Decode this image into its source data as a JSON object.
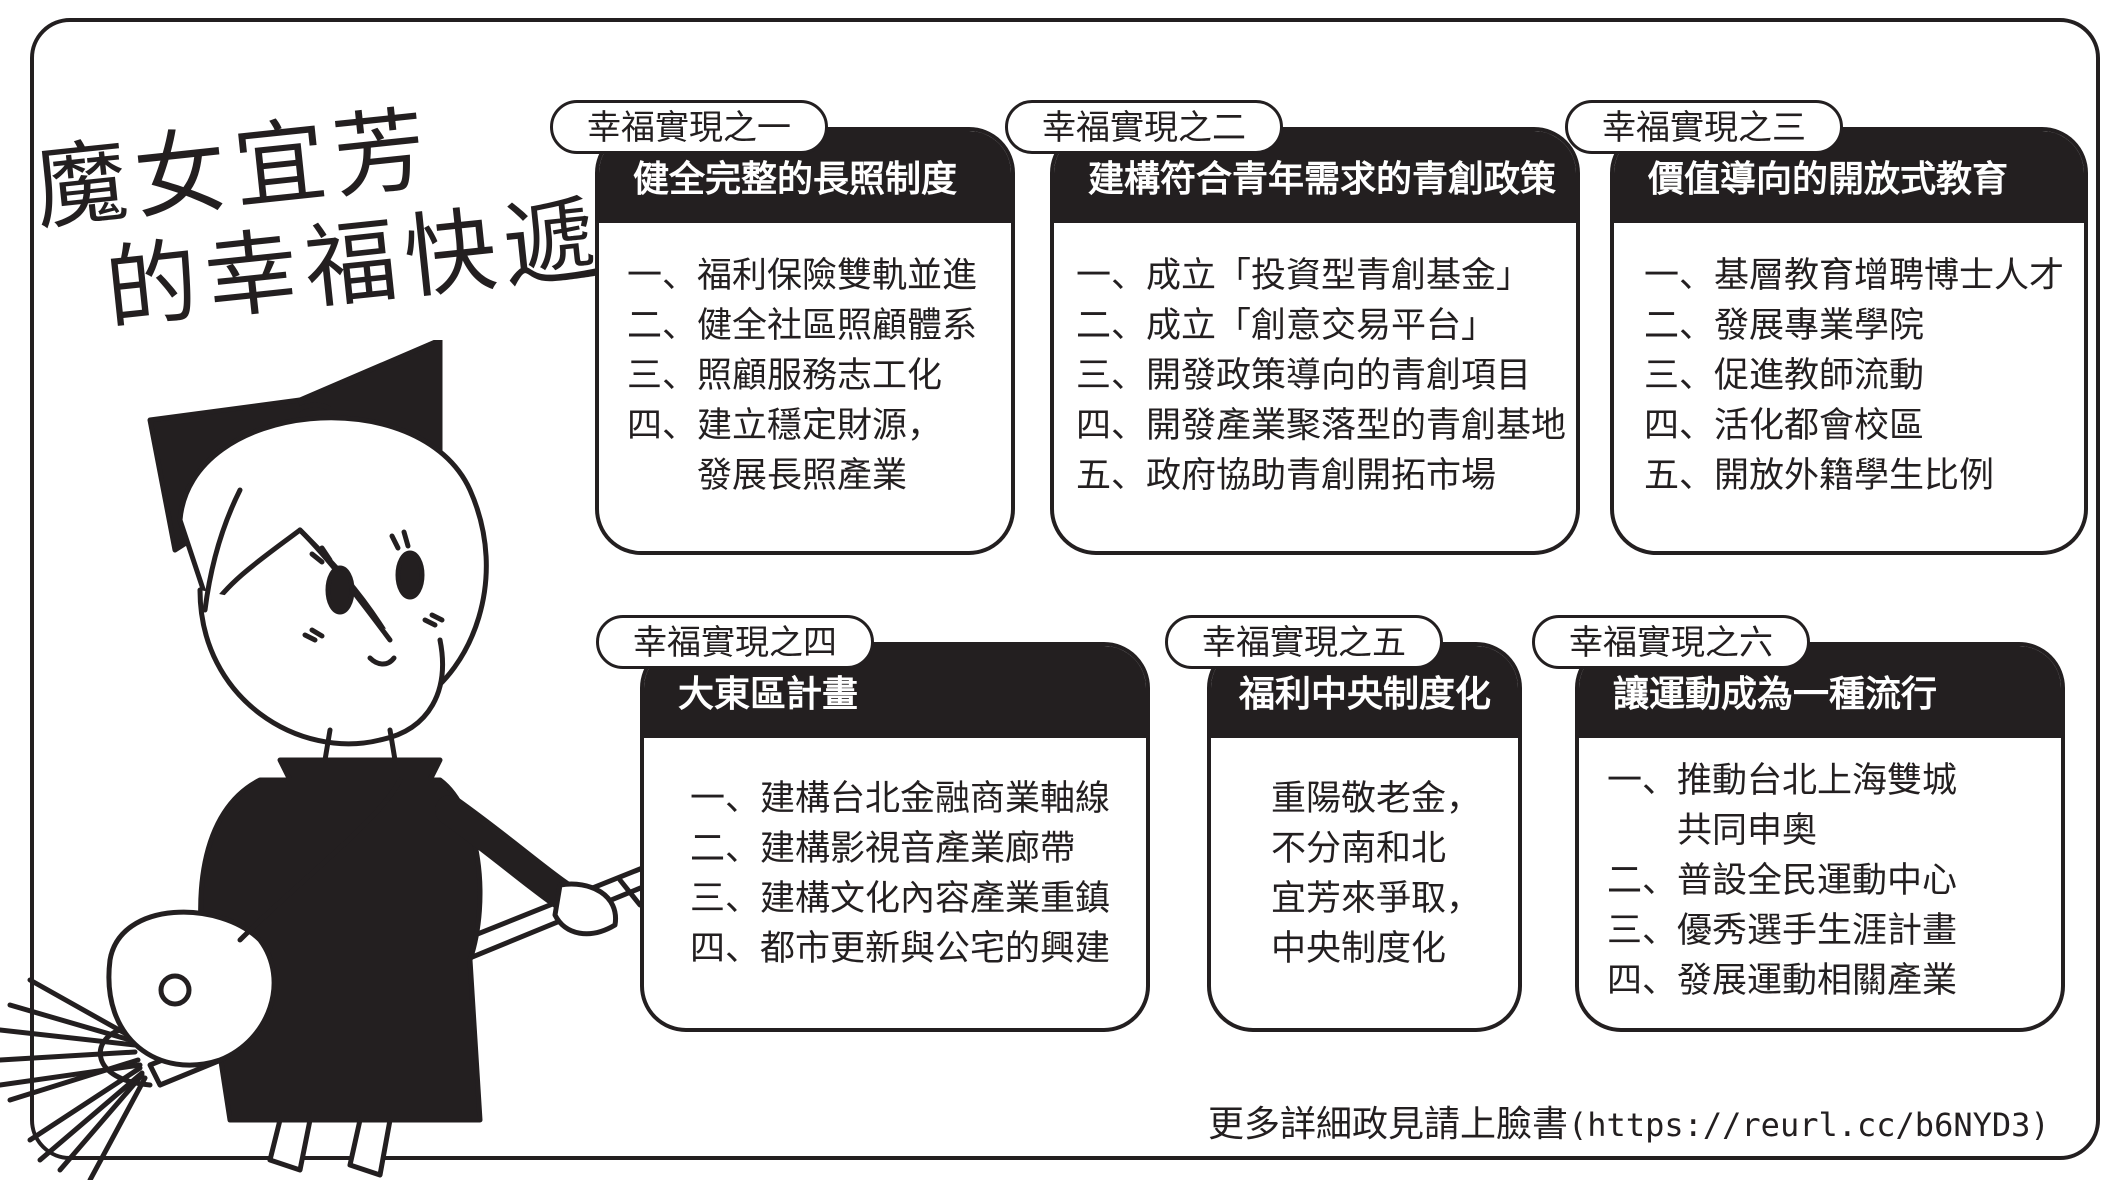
{
  "title": {
    "line1": "魔女宜芳",
    "line2": "的幸福快遞"
  },
  "cards": [
    {
      "tag": "幸福實現之一",
      "heading": "健全完整的長照制度",
      "items": [
        "一、福利保險雙軌並進",
        "二、健全社區照顧體系",
        "三、照顧服務志工化",
        "四、建立穩定財源，",
        "發展長照產業"
      ]
    },
    {
      "tag": "幸福實現之二",
      "heading": "建構符合青年需求的青創政策",
      "items": [
        "一、成立「投資型青創基金」",
        "二、成立「創意交易平台」",
        "三、開發政策導向的青創項目",
        "四、開發產業聚落型的青創基地",
        "五、政府協助青創開拓市場"
      ]
    },
    {
      "tag": "幸福實現之三",
      "heading": "價值導向的開放式教育",
      "items": [
        "一、基層教育增聘博士人才",
        "二、發展專業學院",
        "三、促進教師流動",
        "四、活化都會校區",
        "五、開放外籍學生比例"
      ]
    },
    {
      "tag": "幸福實現之四",
      "heading": "大東區計畫",
      "items": [
        "一、建構台北金融商業軸線",
        "二、建構影視音產業廊帶",
        "三、建構文化內容產業重鎮",
        "四、都市更新與公宅的興建"
      ]
    },
    {
      "tag": "幸福實現之五",
      "heading": "福利中央制度化",
      "items": [
        "重陽敬老金，",
        "不分南和北",
        "宜芳來爭取，",
        "中央制度化"
      ]
    },
    {
      "tag": "幸福實現之六",
      "heading": "讓運動成為一種流行",
      "items": [
        "一、推動台北上海雙城",
        "共同申奧",
        "二、普設全民運動中心",
        "三、優秀選手生涯計畫",
        "四、發展運動相關產業"
      ]
    }
  ],
  "footer": {
    "text": "更多詳細政見請上臉書",
    "url": "(https://reurl.cc/b6NYD3)"
  },
  "colors": {
    "ink": "#231f20",
    "paper": "#ffffff"
  }
}
